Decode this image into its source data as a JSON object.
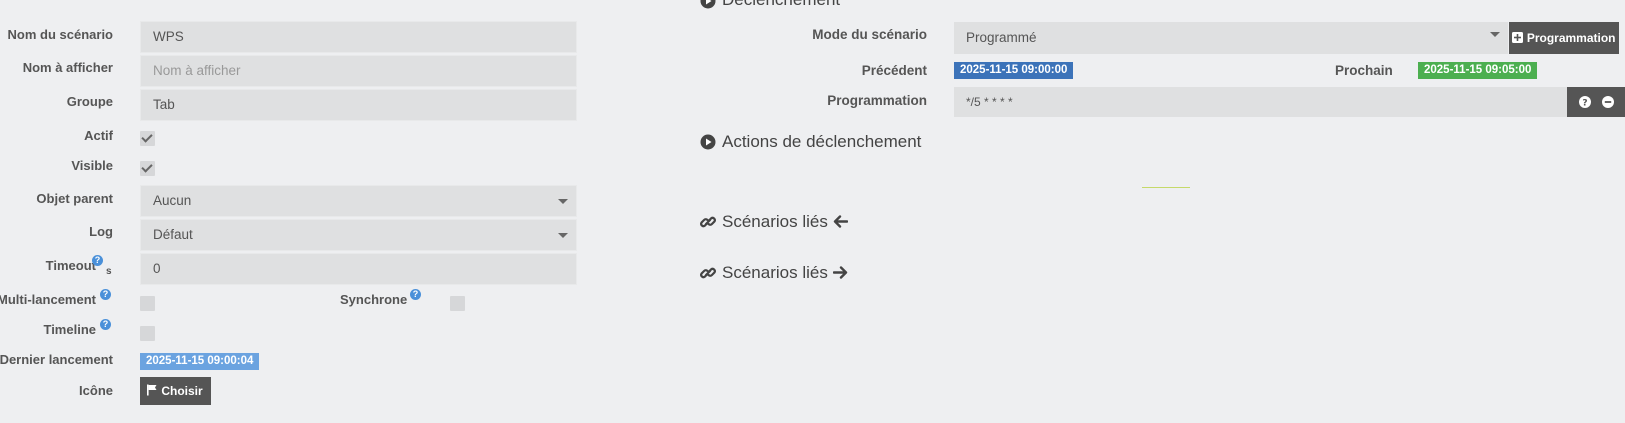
{
  "left": {
    "name": {
      "label": "Nom du scénario",
      "value": "WPS"
    },
    "display": {
      "label": "Nom à afficher",
      "placeholder": "Nom à afficher"
    },
    "group": {
      "label": "Groupe",
      "value": "Tab"
    },
    "active": {
      "label": "Actif",
      "checked": true
    },
    "visible": {
      "label": "Visible",
      "checked": true
    },
    "parent": {
      "label": "Objet parent",
      "value": "Aucun"
    },
    "log": {
      "label": "Log",
      "value": "Défaut"
    },
    "timeout": {
      "label": "Timeout",
      "unit": "s",
      "value": "0"
    },
    "multi": {
      "label": "Multi-lancement",
      "checked": false
    },
    "sync": {
      "label": "Synchrone",
      "checked": false
    },
    "timeline": {
      "label": "Timeline",
      "checked": false
    },
    "last_run": {
      "label": "Dernier lancement",
      "value": "2025-11-15 09:00:04"
    },
    "icon": {
      "label": "Icône",
      "button": "Choisir"
    }
  },
  "right": {
    "trigger_title": "Déclenchement",
    "mode": {
      "label": "Mode du scénario",
      "value": "Programmé",
      "add_button": "Programmation"
    },
    "previous": {
      "label": "Précédent",
      "value": "2025-11-15 09:00:00"
    },
    "next": {
      "label": "Prochain",
      "value": "2025-11-15 09:05:00"
    },
    "schedule": {
      "label": "Programmation",
      "value": "*/5 * * * *"
    },
    "actions_title": "Actions de déclenchement",
    "linked_in": "Scénarios liés",
    "linked_out": "Scénarios liés"
  },
  "colors": {
    "previous": "#3c73b9",
    "next": "#4caf50",
    "last_run": "#6ba3e0",
    "help": "#4a90d9"
  },
  "icons": [
    "question-icon",
    "flag-icon",
    "plus-icon",
    "minus-icon",
    "play-icon",
    "link-icon",
    "arrow-left-icon",
    "arrow-right-icon"
  ]
}
